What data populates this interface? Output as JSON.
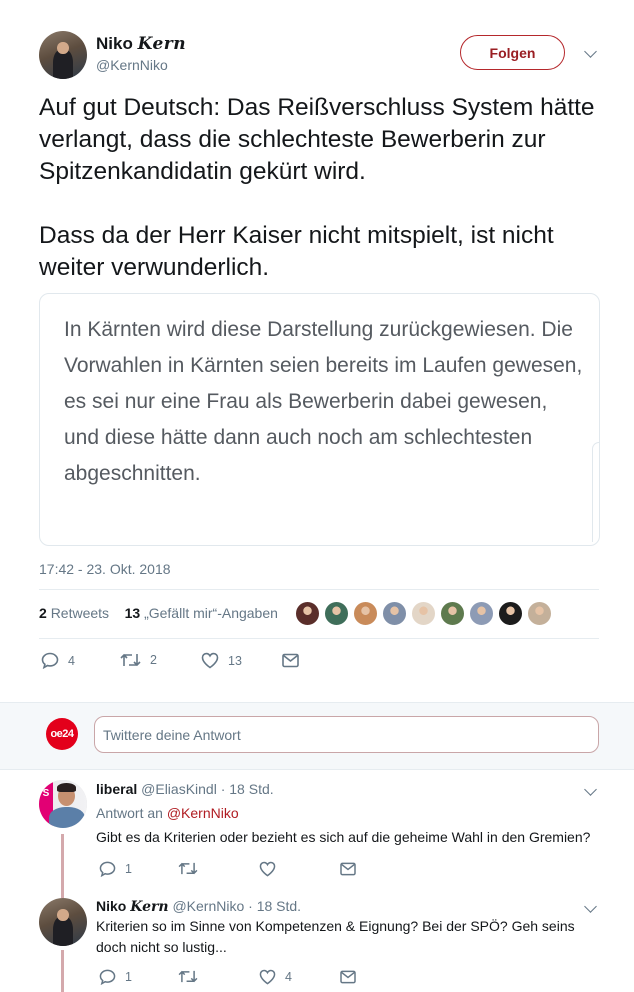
{
  "tweet": {
    "author_name": "Niko",
    "author_name_styled": "Kern",
    "author_handle": "@KernNiko",
    "follow_label": "Folgen",
    "text": "Auf gut Deutsch: Das Reißverschluss System hätte verlangt, dass die schlechteste Bewerberin zur Spitzenkandidatin gekürt wird.\n\nDass da der Herr Kaiser nicht mitspielt, ist nicht weiter verwunderlich.",
    "quote_text": "In Kärnten wird diese Darstellung zurückgewiesen. Die Vorwahlen in Kärnten seien bereits im Laufen gewesen,  es sei nur eine Frau als Bewerberin dabei gewesen, und diese hätte dann auch noch am schlechtesten abgeschnitten.",
    "timestamp": "17:42 - 23. Okt. 2018",
    "retweets_count": "2",
    "retweets_label": "Retweets",
    "likes_count": "13",
    "likes_label": "„Gefällt mir“-Angaben",
    "actions": {
      "reply_count": "4",
      "retweet_count": "2",
      "like_count": "13"
    },
    "liker_face_colors": [
      "#5a2e2a",
      "#3f6e5a",
      "#c98b5a",
      "#7f8fa8",
      "#e3d6c7",
      "#5e7a4e",
      "#8d9bb5",
      "#1c1c1c",
      "#c4b09a"
    ]
  },
  "reply_box": {
    "logo_text": "oe24",
    "placeholder": "Twittere deine Antwort"
  },
  "replies": [
    {
      "name": "liberal",
      "handle": "@EliasKindl",
      "time": "· 18 Std.",
      "reply_to_label": "Antwort an",
      "reply_to_handle": "@KernNiko",
      "text": "Gibt es da Kriterien oder bezieht es sich auf die geheime Wahl in den Gremien?",
      "reply_count": "1",
      "retweet_count": "",
      "like_count": ""
    },
    {
      "name": "Niko",
      "name_styled": "Kern",
      "handle": "@KernNiko",
      "time": "· 18 Std.",
      "text": "Kriterien so im Sinne von Kompetenzen & Eignung? Bei der SPÖ? Geh seins doch nicht so lustig...",
      "reply_count": "1",
      "retweet_count": "",
      "like_count": "4"
    }
  ],
  "colors": {
    "accent": "#9a1e23",
    "text": "#14171a",
    "muted": "#657786",
    "thread_line": "#d4a9ac"
  },
  "icons": [
    "reply-icon",
    "retweet-icon",
    "like-icon",
    "dm-icon",
    "chevron-down-icon"
  ]
}
